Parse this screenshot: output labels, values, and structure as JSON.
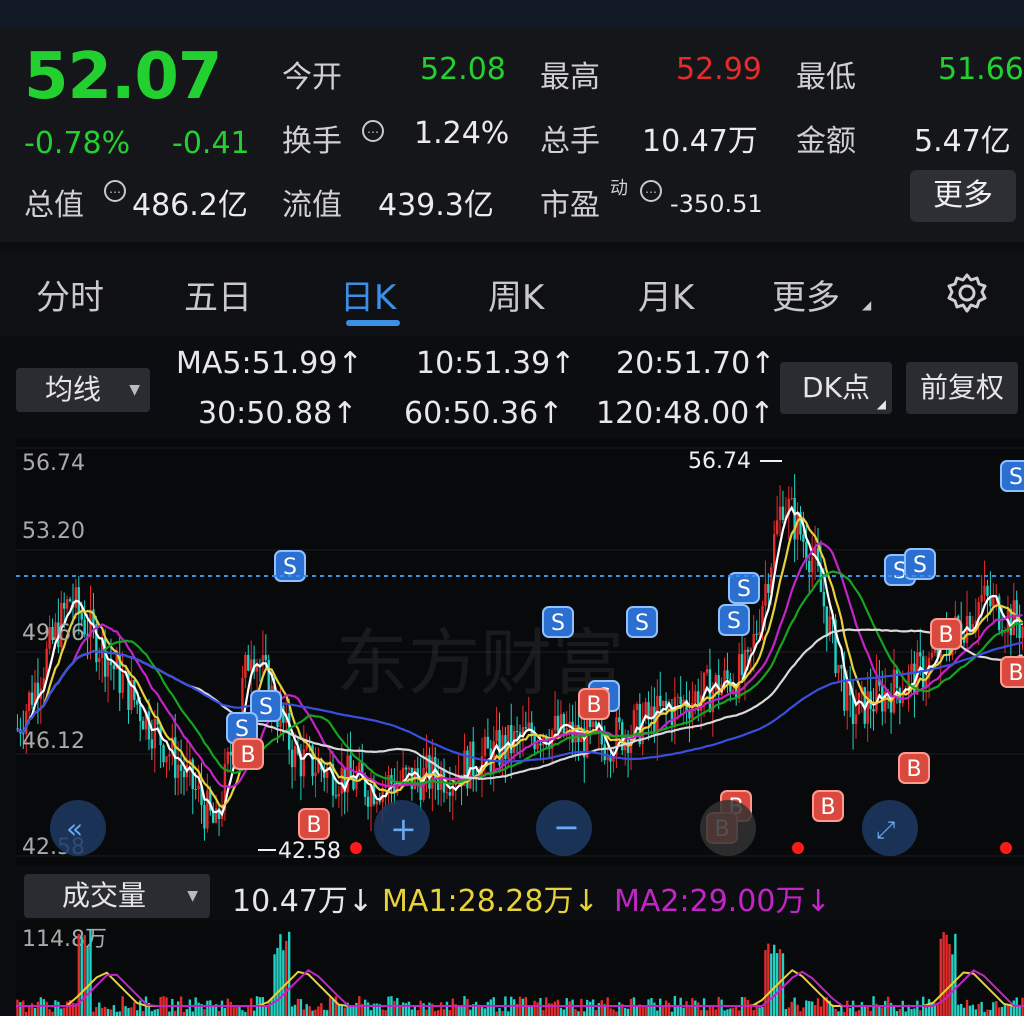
{
  "quote": {
    "price": "52.07",
    "change_pct": "-0.78%",
    "change": "-0.41",
    "open_label": "今开",
    "open_value": "52.08",
    "high_label": "最高",
    "high_value": "52.99",
    "low_label": "最低",
    "low_value": "51.66",
    "turnover_label": "换手",
    "turnover_value": "1.24%",
    "volume_label": "总手",
    "volume_value": "10.47万",
    "amount_label": "金额",
    "amount_value": "5.47亿",
    "mktcap_label": "总值",
    "mktcap_value": "486.2亿",
    "float_label": "流值",
    "float_value": "439.3亿",
    "pe_label": "市盈",
    "pe_sup": "动",
    "pe_value": "-350.51",
    "more_label": "更多"
  },
  "tabs": [
    "分时",
    "五日",
    "日K",
    "周K",
    "月K",
    "更多"
  ],
  "active_tab": "日K",
  "ma_bar": {
    "selector": "均线",
    "dk_label": "DK点",
    "fq_label": "前复权",
    "items": [
      {
        "text": "MA5:51.99",
        "arrow": "↑",
        "color": "#e8e8e8"
      },
      {
        "text": "10:51.39",
        "arrow": "↑",
        "color": "#e6d23a"
      },
      {
        "text": "20:51.70",
        "arrow": "↑",
        "color": "#c324c6"
      },
      {
        "text": "30:50.88",
        "arrow": "↑",
        "color": "#17a21f"
      },
      {
        "text": "60:50.36",
        "arrow": "↑",
        "color": "#d8d8d8"
      },
      {
        "text": "120:48.00",
        "arrow": "↑",
        "color": "#3a4fe0"
      }
    ]
  },
  "chart_data": {
    "type": "candlestick",
    "y_ticks": [
      "56.74",
      "53.20",
      "49.66",
      "46.12",
      "42.58"
    ],
    "ylim": [
      42.58,
      56.74
    ],
    "reference_price": 52.07,
    "high_annotation": "56.74",
    "low_annotation": "42.58",
    "watermark": "东方财富",
    "sell_marker": "S",
    "buy_marker": "B",
    "ma_colors": {
      "ma5": "#ffffff",
      "ma10": "#e6d23a",
      "ma20": "#c324c6",
      "ma30": "#17a21f",
      "ma60": "#d8d8d8",
      "ma120": "#3a4fe0"
    }
  },
  "volume": {
    "selector": "成交量",
    "current": "10.47万",
    "current_arrow": "↓",
    "ma1": "MA1:28.28万",
    "ma1_arrow": "↓",
    "ma2": "MA2:29.00万",
    "ma2_arrow": "↓",
    "max_label": "114.8万"
  },
  "colors": {
    "up": "#e62b2b",
    "down": "#22d1c4",
    "green": "#22d130",
    "accent": "#3c8fe6"
  }
}
